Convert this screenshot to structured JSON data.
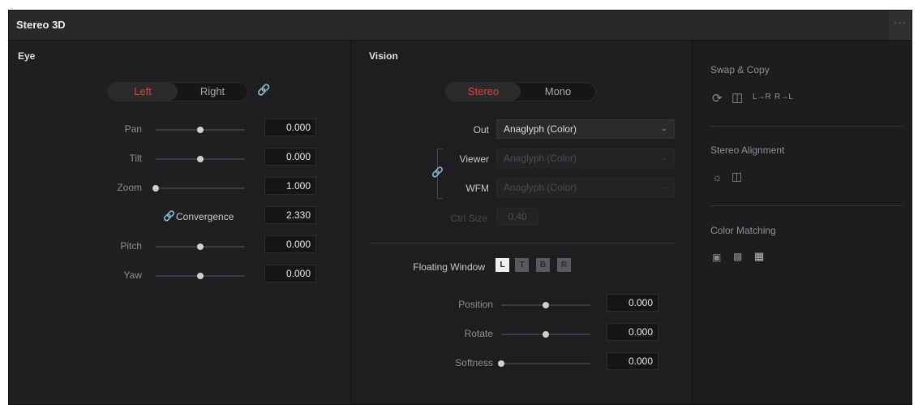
{
  "panel": {
    "title": "Stereo 3D",
    "more_label": "···"
  },
  "eye": {
    "section_title": "Eye",
    "toggle": {
      "left": "Left",
      "right": "Right"
    },
    "pan": {
      "label": "Pan",
      "value": "0.000",
      "level": 0.5
    },
    "tilt": {
      "label": "Tilt",
      "value": "0.000",
      "level": 0.5
    },
    "zoom": {
      "label": "Zoom",
      "value": "1.000",
      "level": 0.0
    },
    "convergence": {
      "label": "Convergence",
      "value": "2.330"
    },
    "pitch": {
      "label": "Pitch",
      "value": "0.000",
      "level": 0.5
    },
    "yaw": {
      "label": "Yaw",
      "value": "0.000",
      "level": 0.5
    }
  },
  "vision": {
    "section_title": "Vision",
    "mode": {
      "stereo": "Stereo",
      "mono": "Mono"
    },
    "out": {
      "label": "Out",
      "value": "Anaglyph (Color)"
    },
    "viewer": {
      "label": "Viewer",
      "value": "Anaglyph (Color)"
    },
    "wfm": {
      "label": "WFM",
      "value": "Anaglyph (Color)"
    },
    "ctrl_size": {
      "label": "Ctrl Size",
      "value": "0.40"
    },
    "floating_window": {
      "label": "Floating Window",
      "buttons": [
        "L",
        "T",
        "B",
        "R"
      ]
    },
    "position": {
      "label": "Position",
      "value": "0.000",
      "level": 0.5
    },
    "rotate": {
      "label": "Rotate",
      "value": "0.000",
      "level": 0.5
    },
    "softness": {
      "label": "Softness",
      "value": "0.000",
      "level": 0.0
    }
  },
  "side": {
    "swap_copy": {
      "title": "Swap & Copy",
      "l_to_r": "L→R",
      "r_to_l": "R→L"
    },
    "stereo_alignment": {
      "title": "Stereo Alignment"
    },
    "color_matching": {
      "title": "Color Matching"
    }
  },
  "colors": {
    "accent_red": "#e0413b",
    "background": "#1c1c1e"
  }
}
